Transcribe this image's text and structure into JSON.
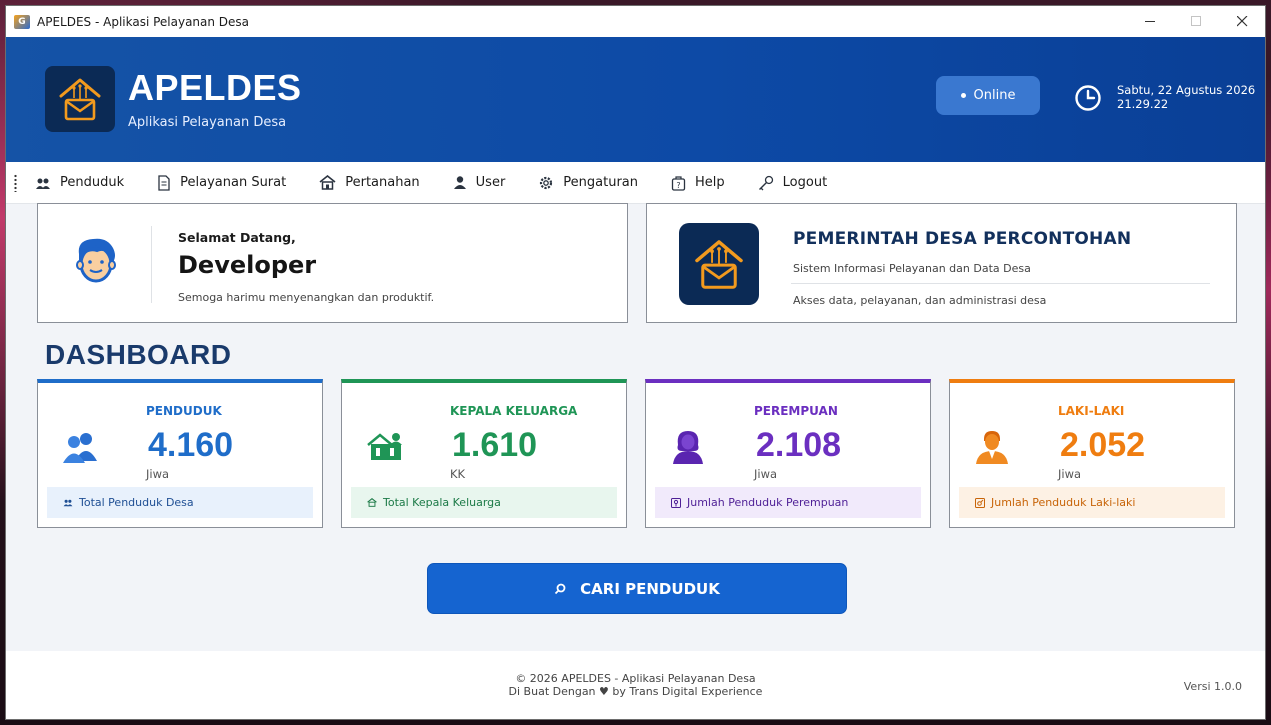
{
  "window": {
    "title": "APELDES - Aplikasi Pelayanan Desa",
    "app_icon_text": "G"
  },
  "header": {
    "brand": "APELDES",
    "tagline": "Aplikasi Pelayanan Desa",
    "status": "Online",
    "date": "Sabtu, 22 Agustus 2026",
    "time": "21.29.22"
  },
  "menu": [
    {
      "label": "Penduduk",
      "icon": "people-icon"
    },
    {
      "label": "Pelayanan Surat",
      "icon": "document-icon"
    },
    {
      "label": "Pertanahan",
      "icon": "house-icon"
    },
    {
      "label": "User",
      "icon": "user-icon"
    },
    {
      "label": "Pengaturan",
      "icon": "gear-icon"
    },
    {
      "label": "Help",
      "icon": "help-icon"
    },
    {
      "label": "Logout",
      "icon": "key-icon"
    }
  ],
  "welcome": {
    "greeting": "Selamat Datang,",
    "name": "Developer",
    "wish": "Semoga harimu menyenangkan dan produktif."
  },
  "village": {
    "title": "PEMERINTAH DESA PERCONTOHAN",
    "subtitle": "Sistem Informasi Pelayanan dan Data Desa",
    "description": "Akses data, pelayanan, dan administrasi desa"
  },
  "dashboard": {
    "title": "DASHBOARD",
    "cards": [
      {
        "label": "PENDUDUK",
        "value": "4.160",
        "unit": "Jiwa",
        "footer": "Total Penduduk Desa",
        "color": "#1f6dc9",
        "foot_bg": "#e8f1fc"
      },
      {
        "label": "KEPALA KELUARGA",
        "value": "1.610",
        "unit": "KK",
        "footer": "Total Kepala Keluarga",
        "color": "#1f9556",
        "foot_bg": "#e8f6ee"
      },
      {
        "label": "PEREMPUAN",
        "value": "2.108",
        "unit": "Jiwa",
        "footer": "Jumlah Penduduk Perempuan",
        "color": "#6b2fc0",
        "foot_bg": "#f1eafb"
      },
      {
        "label": "LAKI-LAKI",
        "value": "2.052",
        "unit": "Jiwa",
        "footer": "Jumlah Penduduk Laki-laki",
        "color": "#ef7d10",
        "foot_bg": "#fdf1e4"
      }
    ]
  },
  "search_button": {
    "label": "CARI PENDUDUK"
  },
  "footer": {
    "copyright": "© 2026 APELDES - Aplikasi Pelayanan Desa",
    "made_with": "Di Buat Dengan ♥ by Trans Digital Experience",
    "version": "Versi 1.0.0"
  }
}
